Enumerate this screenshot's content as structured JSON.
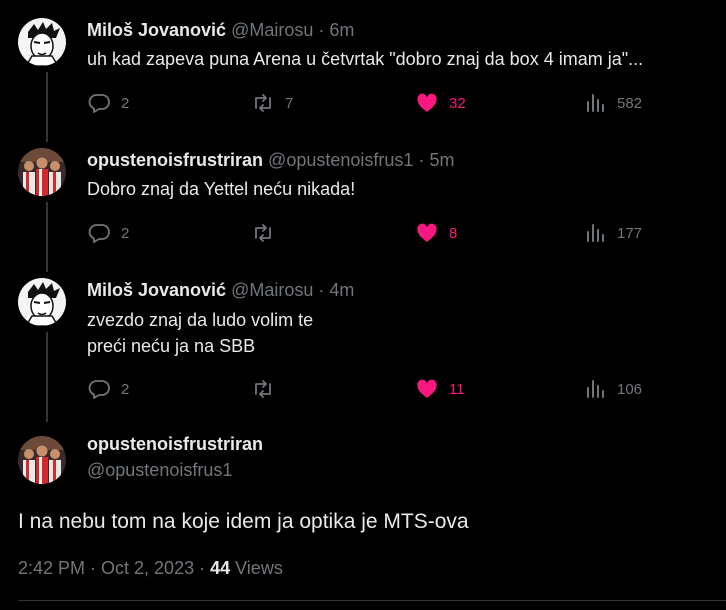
{
  "replies": [
    {
      "name": "Miloš Jovanović",
      "handle": "@Mairosu",
      "time": "6m",
      "text": "uh kad zapeva puna Arena u četvrtak \"dobro znaj da box 4 imam ja\"...",
      "replies_count": "2",
      "retweets_count": "7",
      "likes_count": "32",
      "views_count": "582"
    },
    {
      "name": "opustenoisfrustriran",
      "handle": "@opustenoisfrus1",
      "time": "5m",
      "text": "Dobro znaj da Yettel neću nikada!",
      "replies_count": "2",
      "retweets_count": "",
      "likes_count": "8",
      "views_count": "177"
    },
    {
      "name": "Miloš Jovanović",
      "handle": "@Mairosu",
      "time": "4m",
      "text": "zvezdo znaj da ludo volim te\npreći neću ja na SBB",
      "replies_count": "2",
      "retweets_count": "",
      "likes_count": "11",
      "views_count": "106"
    }
  ],
  "main_tweet": {
    "name": "opustenoisfrustriran",
    "handle": "@opustenoisfrus1",
    "text": "I na nebu tom na koje idem ja optika je MTS-ova",
    "timestamp": "2:42 PM · Oct 2, 2023 · ",
    "views_count": "44",
    "views_label": " Views"
  },
  "separator": "·",
  "icons": {
    "reply": "reply-icon",
    "retweet": "retweet-icon",
    "like": "heart-icon",
    "views": "views-icon"
  },
  "colors": {
    "background": "#000000",
    "text": "#e7e9ea",
    "muted": "#71767b",
    "like": "#f91880",
    "thread_line": "#333639"
  }
}
